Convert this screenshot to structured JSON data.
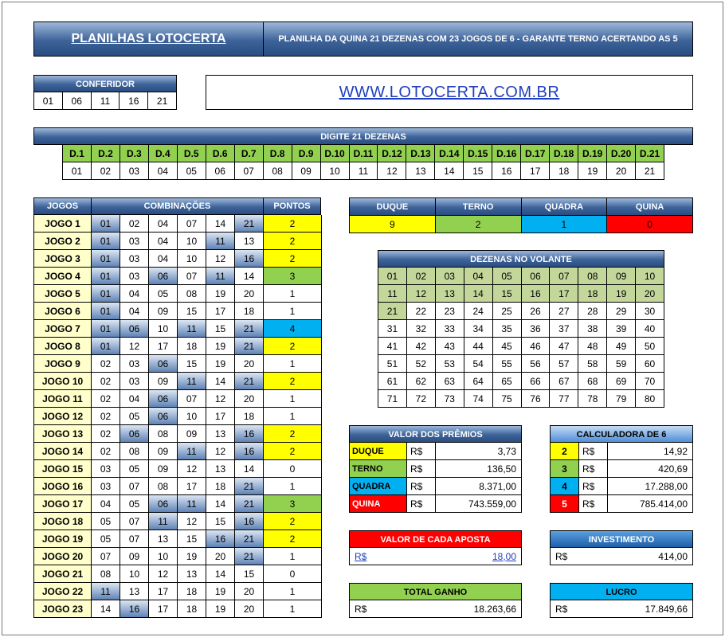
{
  "top": {
    "brand": "PLANILHAS LOTOCERTA",
    "subtitle": "PLANILHA DA QUINA 21 DEZENAS COM 23 JOGOS DE 6 - GARANTE TERNO ACERTANDO AS 5"
  },
  "conferidor": {
    "title": "CONFERIDOR",
    "numbers": [
      "01",
      "06",
      "11",
      "16",
      "21"
    ]
  },
  "website": "WWW.LOTOCERTA.COM.BR",
  "digite": {
    "title": "DIGITE 21 DEZENAS",
    "labels": [
      "D.1",
      "D.2",
      "D.3",
      "D.4",
      "D.5",
      "D.6",
      "D.7",
      "D.8",
      "D.9",
      "D.10",
      "D.11",
      "D.12",
      "D.13",
      "D.14",
      "D.15",
      "D.16",
      "D.17",
      "D.18",
      "D.19",
      "D.20",
      "D.21"
    ],
    "values": [
      "01",
      "02",
      "03",
      "04",
      "05",
      "06",
      "07",
      "08",
      "09",
      "10",
      "11",
      "12",
      "13",
      "14",
      "15",
      "16",
      "17",
      "18",
      "19",
      "20",
      "21"
    ]
  },
  "games": {
    "headers": [
      "JOGOS",
      "COMBINAÇÕES",
      "PONTOS"
    ],
    "rows": [
      {
        "name": "JOGO 1",
        "nums": [
          "01",
          "02",
          "04",
          "07",
          "14",
          "21"
        ],
        "pts": "2"
      },
      {
        "name": "JOGO 2",
        "nums": [
          "01",
          "03",
          "04",
          "10",
          "11",
          "13"
        ],
        "pts": "2"
      },
      {
        "name": "JOGO 3",
        "nums": [
          "01",
          "03",
          "04",
          "10",
          "12",
          "16"
        ],
        "pts": "2"
      },
      {
        "name": "JOGO 4",
        "nums": [
          "01",
          "03",
          "06",
          "07",
          "11",
          "14"
        ],
        "pts": "3"
      },
      {
        "name": "JOGO 5",
        "nums": [
          "01",
          "04",
          "05",
          "08",
          "19",
          "20"
        ],
        "pts": "1"
      },
      {
        "name": "JOGO 6",
        "nums": [
          "01",
          "04",
          "09",
          "15",
          "17",
          "18"
        ],
        "pts": "1"
      },
      {
        "name": "JOGO 7",
        "nums": [
          "01",
          "06",
          "10",
          "11",
          "15",
          "21"
        ],
        "pts": "4"
      },
      {
        "name": "JOGO 8",
        "nums": [
          "01",
          "12",
          "17",
          "18",
          "19",
          "21"
        ],
        "pts": "2"
      },
      {
        "name": "JOGO 9",
        "nums": [
          "02",
          "03",
          "06",
          "15",
          "19",
          "20"
        ],
        "pts": "1"
      },
      {
        "name": "JOGO 10",
        "nums": [
          "02",
          "03",
          "09",
          "11",
          "14",
          "21"
        ],
        "pts": "2"
      },
      {
        "name": "JOGO 11",
        "nums": [
          "02",
          "04",
          "06",
          "07",
          "12",
          "20"
        ],
        "pts": "1"
      },
      {
        "name": "JOGO 12",
        "nums": [
          "02",
          "05",
          "06",
          "10",
          "17",
          "18"
        ],
        "pts": "1"
      },
      {
        "name": "JOGO 13",
        "nums": [
          "02",
          "06",
          "08",
          "09",
          "13",
          "16"
        ],
        "pts": "2"
      },
      {
        "name": "JOGO 14",
        "nums": [
          "02",
          "08",
          "09",
          "11",
          "12",
          "16"
        ],
        "pts": "2"
      },
      {
        "name": "JOGO 15",
        "nums": [
          "03",
          "05",
          "09",
          "12",
          "13",
          "14"
        ],
        "pts": "0"
      },
      {
        "name": "JOGO 16",
        "nums": [
          "03",
          "07",
          "08",
          "17",
          "18",
          "21"
        ],
        "pts": "1"
      },
      {
        "name": "JOGO 17",
        "nums": [
          "04",
          "05",
          "06",
          "11",
          "14",
          "21"
        ],
        "pts": "3"
      },
      {
        "name": "JOGO 18",
        "nums": [
          "05",
          "07",
          "11",
          "12",
          "15",
          "16"
        ],
        "pts": "2"
      },
      {
        "name": "JOGO 19",
        "nums": [
          "05",
          "07",
          "13",
          "15",
          "16",
          "21"
        ],
        "pts": "2"
      },
      {
        "name": "JOGO 20",
        "nums": [
          "07",
          "09",
          "10",
          "19",
          "20",
          "21"
        ],
        "pts": "1"
      },
      {
        "name": "JOGO 21",
        "nums": [
          "08",
          "10",
          "12",
          "13",
          "14",
          "15"
        ],
        "pts": "0"
      },
      {
        "name": "JOGO 22",
        "nums": [
          "11",
          "13",
          "17",
          "18",
          "19",
          "20"
        ],
        "pts": "1"
      },
      {
        "name": "JOGO 23",
        "nums": [
          "14",
          "16",
          "17",
          "18",
          "19",
          "20"
        ],
        "pts": "1"
      }
    ]
  },
  "hits": {
    "labels": [
      "DUQUE",
      "TERNO",
      "QUADRA",
      "QUINA"
    ],
    "values": [
      "9",
      "2",
      "1",
      "0"
    ]
  },
  "volante": {
    "title": "DEZENAS NO VOLANTE",
    "numbers": [
      "01",
      "02",
      "03",
      "04",
      "05",
      "06",
      "07",
      "08",
      "09",
      "10",
      "11",
      "12",
      "13",
      "14",
      "15",
      "16",
      "17",
      "18",
      "19",
      "20",
      "21",
      "22",
      "23",
      "24",
      "25",
      "26",
      "27",
      "28",
      "29",
      "30",
      "31",
      "32",
      "33",
      "34",
      "35",
      "36",
      "37",
      "38",
      "39",
      "40",
      "41",
      "42",
      "43",
      "44",
      "45",
      "46",
      "47",
      "48",
      "49",
      "50",
      "51",
      "52",
      "53",
      "54",
      "55",
      "56",
      "57",
      "58",
      "59",
      "60",
      "61",
      "62",
      "63",
      "64",
      "65",
      "66",
      "67",
      "68",
      "69",
      "70",
      "71",
      "72",
      "73",
      "74",
      "75",
      "76",
      "77",
      "78",
      "79",
      "80"
    ]
  },
  "premios": {
    "title": "VALOR DOS PRÊMIOS",
    "currency": "R$",
    "rows": [
      {
        "label": "DUQUE",
        "value": "3,73"
      },
      {
        "label": "TERNO",
        "value": "136,50"
      },
      {
        "label": "QUADRA",
        "value": "8.371,00"
      },
      {
        "label": "QUINA",
        "value": "743.559,00"
      }
    ]
  },
  "calculadora": {
    "title": "CALCULADORA DE 6",
    "currency": "R$",
    "rows": [
      {
        "label": "2",
        "value": "14,92"
      },
      {
        "label": "3",
        "value": "420,69"
      },
      {
        "label": "4",
        "value": "17.288,00"
      },
      {
        "label": "5",
        "value": "785.414,00"
      }
    ]
  },
  "aposta": {
    "title": "VALOR DE CADA APOSTA",
    "currency": "R$",
    "value": "18,00"
  },
  "investimento": {
    "title": "INVESTIMENTO",
    "currency": "R$",
    "value": "414,00"
  },
  "total": {
    "title": "TOTAL GANHO",
    "currency": "R$",
    "value": "18.263,66"
  },
  "lucro": {
    "title": "LUCRO",
    "currency": "R$",
    "value": "17.849,66"
  },
  "colors": {
    "yellow": "#ffff00",
    "green": "#92d050",
    "blue": "#00b0f0",
    "red": "#ff0000",
    "navy": "#2a4d80"
  }
}
